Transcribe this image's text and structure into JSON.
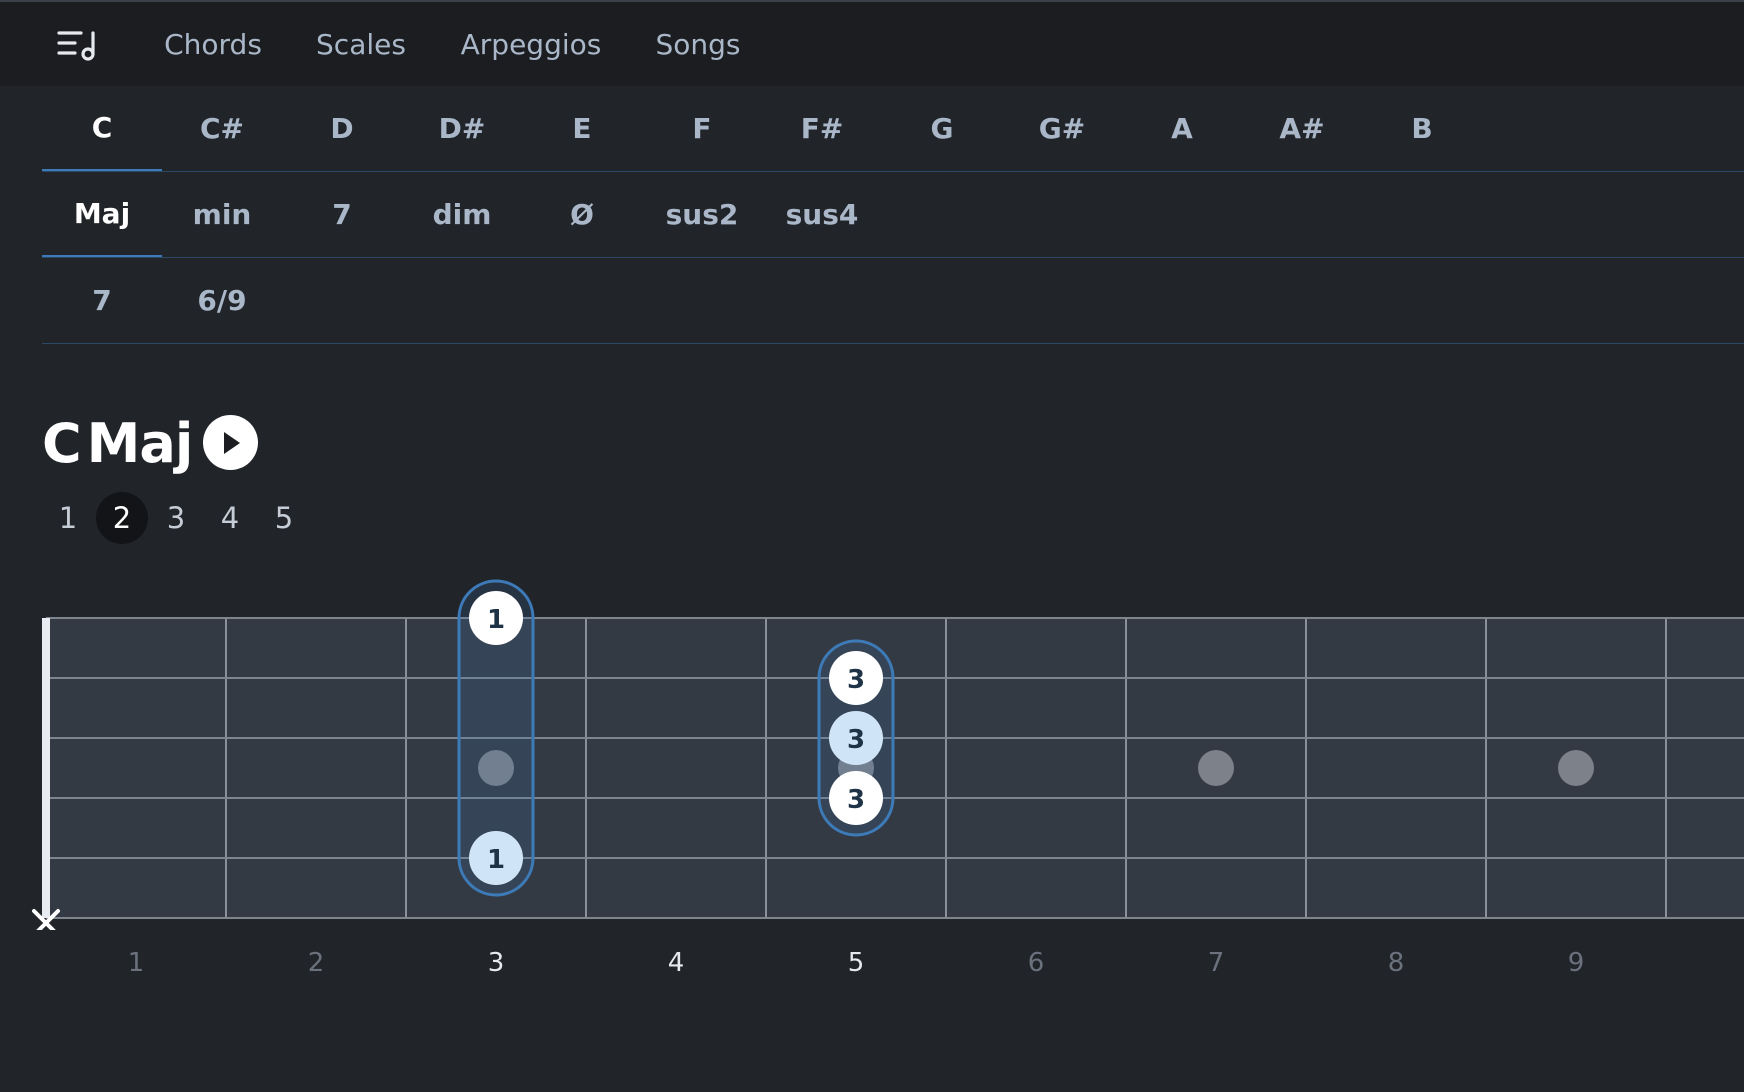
{
  "nav": {
    "menu_icon": "menu-music-icon",
    "tabs": [
      {
        "label": "Chords",
        "active": true
      },
      {
        "label": "Scales",
        "active": false
      },
      {
        "label": "Arpeggios",
        "active": false
      },
      {
        "label": "Songs",
        "active": false
      }
    ]
  },
  "roots": [
    "C",
    "C#",
    "D",
    "D#",
    "E",
    "F",
    "F#",
    "G",
    "G#",
    "A",
    "A#",
    "B"
  ],
  "root_selected": "C",
  "qualities": [
    "Maj",
    "min",
    "7",
    "dim",
    "Ø",
    "sus2",
    "sus4"
  ],
  "quality_selected": "Maj",
  "extensions": [
    "7",
    "6/9"
  ],
  "chord": {
    "root": "C",
    "quality": "Maj",
    "play_icon": "play-icon"
  },
  "voicings": {
    "items": [
      "1",
      "2",
      "3",
      "4",
      "5"
    ],
    "selected": "2"
  },
  "fretboard": {
    "string_count": 6,
    "muted_string_marker": "×",
    "muted_string": 6,
    "fret_numbers": [
      "1",
      "2",
      "3",
      "4",
      "5",
      "6",
      "7",
      "8",
      "9"
    ],
    "highlighted_frets": [
      "3",
      "4",
      "5"
    ],
    "inlay_frets": [
      3,
      5,
      7,
      9
    ],
    "barres": [
      {
        "fret": 3,
        "from_string": 1,
        "to_string": 5,
        "finger": "1"
      },
      {
        "fret": 5,
        "from_string": 2,
        "to_string": 4,
        "finger": "3"
      }
    ],
    "notes": [
      {
        "string": 1,
        "fret": 3,
        "finger": "1",
        "root": false
      },
      {
        "string": 5,
        "fret": 3,
        "finger": "1",
        "root": true
      },
      {
        "string": 2,
        "fret": 5,
        "finger": "3",
        "root": false
      },
      {
        "string": 3,
        "fret": 5,
        "finger": "3",
        "root": true
      },
      {
        "string": 4,
        "fret": 5,
        "finger": "3",
        "root": false
      }
    ]
  },
  "colors": {
    "background": "#212429",
    "fretboard": "#343a43",
    "accent": "#3d7ab8",
    "note": "#ffffff",
    "root_note": "#cfe4f7",
    "note_text": "#1f3347"
  }
}
